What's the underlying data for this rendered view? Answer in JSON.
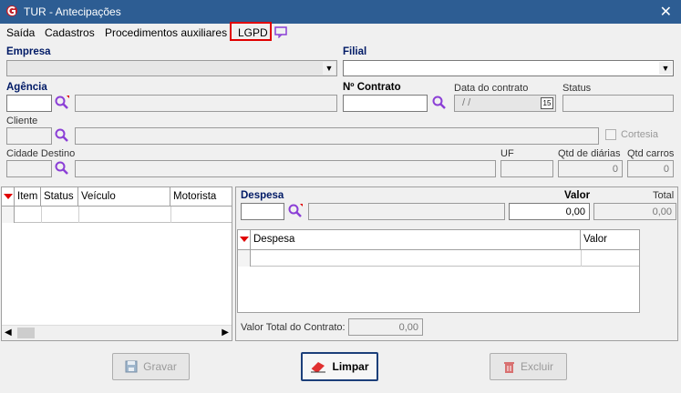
{
  "window": {
    "title": "TUR - Antecipações",
    "close_glyph": "✕"
  },
  "menu": {
    "items": [
      "Saída",
      "Cadastros",
      "Procedimentos auxiliares",
      "LGPD"
    ]
  },
  "form": {
    "empresa_label": "Empresa",
    "filial_label": "Filial",
    "agencia_label": "Agência",
    "contrato_label": "Nº Contrato",
    "data_contrato_label": "Data do contrato",
    "data_contrato_value": " / /",
    "status_label": "Status",
    "cliente_label": "Cliente",
    "cortesia_label": "Cortesia",
    "cidade_label": "Cidade Destino",
    "uf_label": "UF",
    "qtd_diarias_label": "Qtd de diárias",
    "qtd_diarias_value": "0",
    "qtd_carros_label": "Qtd carros",
    "qtd_carros_value": "0"
  },
  "left_grid": {
    "columns": [
      "Item",
      "Status",
      "Veículo",
      "Motorista"
    ]
  },
  "despesa_panel": {
    "despesa_label": "Despesa",
    "valor_label": "Valor",
    "valor_value": "0,00",
    "total_label": "Total",
    "total_value": "0,00",
    "grid_columns": [
      "Despesa",
      "Valor"
    ],
    "valor_total_label": "Valor Total do Contrato:",
    "valor_total_value": "0,00"
  },
  "buttons": {
    "gravar": "Gravar",
    "limpar": "Limpar",
    "excluir": "Excluir"
  },
  "colors": {
    "titlebar": "#2d5d93",
    "accent_red": "#e00000",
    "search_icon": "#8b3fd6"
  }
}
